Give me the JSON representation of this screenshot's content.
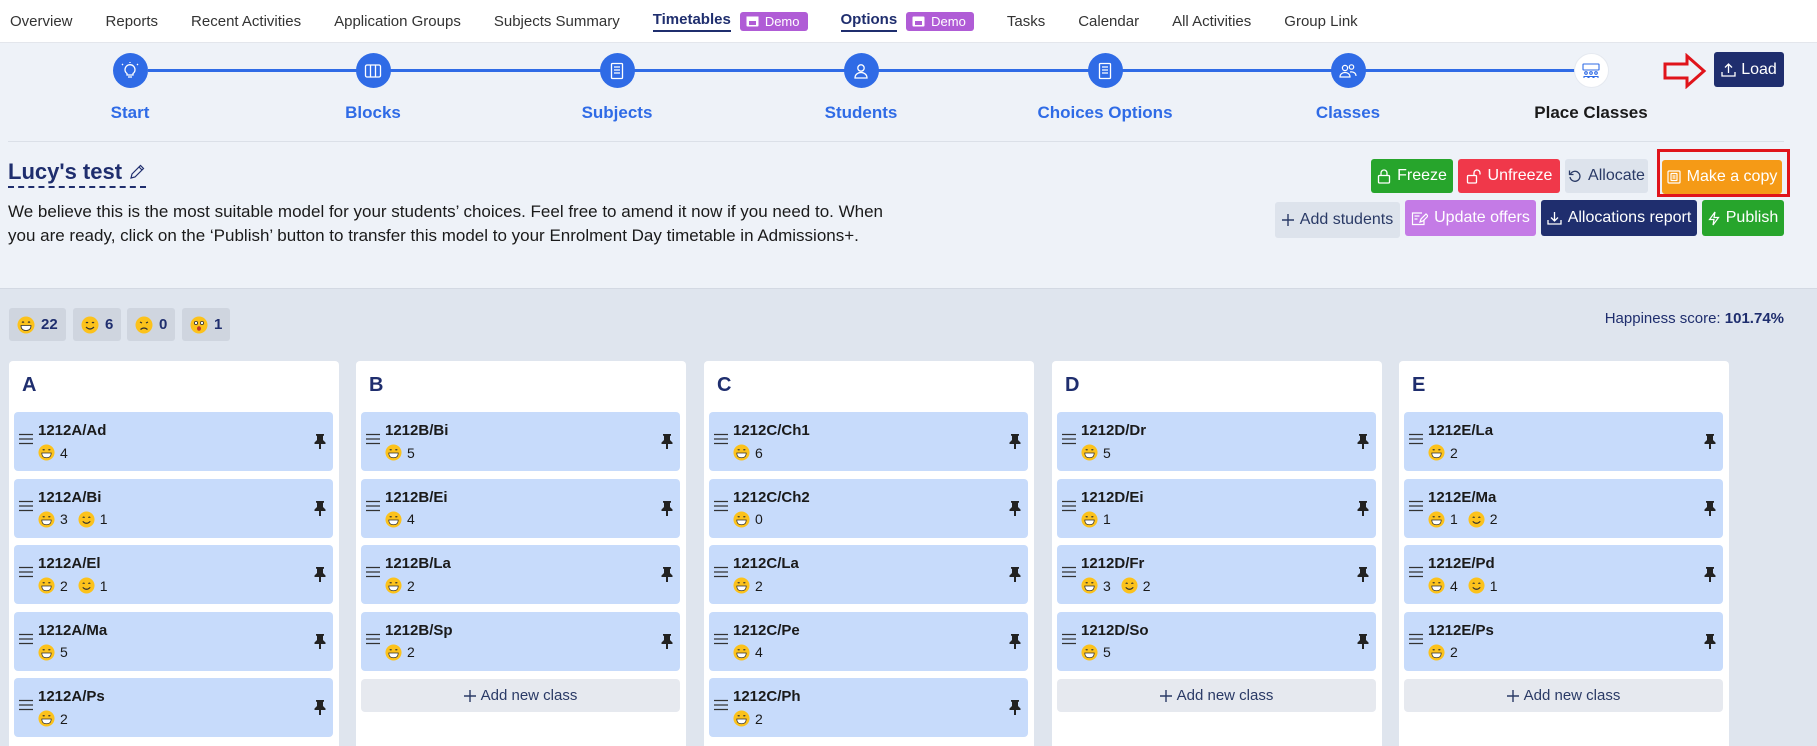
{
  "nav": {
    "items": [
      {
        "label": "Overview"
      },
      {
        "label": "Reports"
      },
      {
        "label": "Recent Activities"
      },
      {
        "label": "Application Groups"
      },
      {
        "label": "Subjects Summary"
      },
      {
        "label": "Timetables",
        "badge": "Demo",
        "active": true
      },
      {
        "label": "Options",
        "badge": "Demo",
        "active": true
      },
      {
        "label": "Tasks"
      },
      {
        "label": "Calendar"
      },
      {
        "label": "All Activities"
      },
      {
        "label": "Group Link"
      }
    ]
  },
  "stepper": {
    "steps": [
      {
        "label": "Start",
        "icon": "lightbulb-icon"
      },
      {
        "label": "Blocks",
        "icon": "columns-icon"
      },
      {
        "label": "Subjects",
        "icon": "book-icon"
      },
      {
        "label": "Students",
        "icon": "user-icon"
      },
      {
        "label": "Choices Options",
        "icon": "list-icon"
      },
      {
        "label": "Classes",
        "icon": "users-icon"
      },
      {
        "label": "Place Classes",
        "icon": "classroom-icon"
      }
    ],
    "load_label": "Load"
  },
  "model": {
    "title": "Lucy's test",
    "description": "We believe this is the most suitable model for your students’ choices. Feel free to amend it now if you need to. When you are ready, click on the ‘Publish’ button to transfer this model to your Enrolment Day timetable in Admissions+."
  },
  "actions": {
    "freeze": "Freeze",
    "unfreeze": "Unfreeze",
    "allocate": "Allocate",
    "make_copy": "Make a copy",
    "add_students": "Add students",
    "update_offers": "Update offers",
    "allocations_report": "Allocations report",
    "publish": "Publish"
  },
  "stats": {
    "very_happy": "22",
    "happy": "6",
    "unhappy": "0",
    "shocked": "1",
    "happiness_label": "Happiness score:",
    "happiness_value": "101.74%"
  },
  "blocks": [
    {
      "name": "A",
      "classes": [
        {
          "name": "1212A/Ad",
          "vh": "4",
          "h": null
        },
        {
          "name": "1212A/Bi",
          "vh": "3",
          "h": "1"
        },
        {
          "name": "1212A/El",
          "vh": "2",
          "h": "1"
        },
        {
          "name": "1212A/Ma",
          "vh": "5",
          "h": null
        },
        {
          "name": "1212A/Ps",
          "vh": "2",
          "h": null
        }
      ],
      "add": ""
    },
    {
      "name": "B",
      "classes": [
        {
          "name": "1212B/Bi",
          "vh": "5",
          "h": null
        },
        {
          "name": "1212B/Ei",
          "vh": "4",
          "h": null
        },
        {
          "name": "1212B/La",
          "vh": "2",
          "h": null
        },
        {
          "name": "1212B/Sp",
          "vh": "2",
          "h": null
        }
      ],
      "add": "Add new class"
    },
    {
      "name": "C",
      "classes": [
        {
          "name": "1212C/Ch1",
          "vh": "6",
          "h": null
        },
        {
          "name": "1212C/Ch2",
          "vh": "0",
          "h": null
        },
        {
          "name": "1212C/La",
          "vh": "2",
          "h": null
        },
        {
          "name": "1212C/Pe",
          "vh": "4",
          "h": null
        },
        {
          "name": "1212C/Ph",
          "vh": "2",
          "h": null
        }
      ],
      "add": ""
    },
    {
      "name": "D",
      "classes": [
        {
          "name": "1212D/Dr",
          "vh": "5",
          "h": null
        },
        {
          "name": "1212D/Ei",
          "vh": "1",
          "h": null
        },
        {
          "name": "1212D/Fr",
          "vh": "3",
          "h": "2"
        },
        {
          "name": "1212D/So",
          "vh": "5",
          "h": null
        }
      ],
      "add": "Add new class"
    },
    {
      "name": "E",
      "classes": [
        {
          "name": "1212E/La",
          "vh": "2",
          "h": null
        },
        {
          "name": "1212E/Ma",
          "vh": "1",
          "h": "2"
        },
        {
          "name": "1212E/Pd",
          "vh": "4",
          "h": "1"
        },
        {
          "name": "1212E/Ps",
          "vh": "2",
          "h": null
        }
      ],
      "add": "Add new class"
    }
  ],
  "colors": {
    "primary": "#1f2e6e",
    "accent": "#2f6be6",
    "card": "#c7dbfb",
    "highlight": "#e0141b"
  }
}
